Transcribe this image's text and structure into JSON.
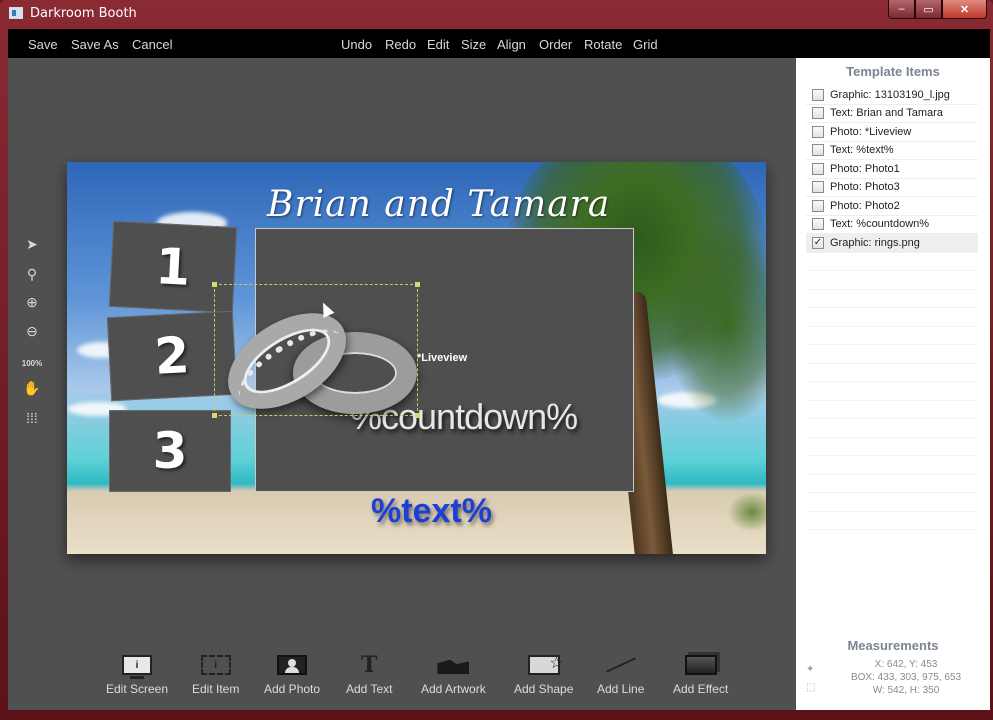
{
  "window": {
    "title": "Darkroom Booth",
    "min_label": "–",
    "max_label": "▭",
    "close_label": "✕"
  },
  "toolbar": {
    "left": [
      "Save",
      "Save As",
      "Cancel"
    ],
    "center": [
      "Undo",
      "Redo",
      "Edit",
      "Size",
      "Align",
      "Order",
      "Rotate",
      "Grid"
    ]
  },
  "canvas": {
    "title": "Brian and Tamara",
    "photo1": "1",
    "photo2": "2",
    "photo3": "3",
    "liveview_label": "*Liveview",
    "countdown": "%countdown%",
    "text_var": "%text%"
  },
  "left_tools": {
    "zoom_label": "100%"
  },
  "bottom_toolbar": [
    {
      "label": "Edit Screen",
      "icon": "monitor-icon"
    },
    {
      "label": "Edit Item",
      "icon": "edit-item-icon"
    },
    {
      "label": "Add Photo",
      "icon": "photo-icon"
    },
    {
      "label": "Add Text",
      "icon": "text-icon"
    },
    {
      "label": "Add Artwork",
      "icon": "artwork-icon"
    },
    {
      "label": "Add Shape",
      "icon": "shape-icon"
    },
    {
      "label": "Add Line",
      "icon": "line-icon"
    },
    {
      "label": "Add Effect",
      "icon": "effect-icon"
    }
  ],
  "template_items": {
    "title": "Template Items",
    "items": [
      {
        "label": "Graphic: 13103190_l.jpg",
        "checked": false
      },
      {
        "label": "Text: Brian and Tamara",
        "checked": false
      },
      {
        "label": "Photo: *Liveview",
        "checked": false
      },
      {
        "label": "Text: %text%",
        "checked": false
      },
      {
        "label": "Photo: Photo1",
        "checked": false
      },
      {
        "label": "Photo: Photo3",
        "checked": false
      },
      {
        "label": "Photo: Photo2",
        "checked": false
      },
      {
        "label": "Text: %countdown%",
        "checked": false
      },
      {
        "label": "Graphic: rings.png",
        "checked": true
      }
    ]
  },
  "measurements": {
    "title": "Measurements",
    "xy": "X: 642, Y: 453",
    "box": "BOX: 433, 303, 975, 653",
    "wh": "W: 542, H: 350"
  },
  "colors": {
    "titlebar": "#8a2a33",
    "toolbar": "#000000",
    "workarea": "#505050",
    "text_var": "#1c3fd6"
  }
}
